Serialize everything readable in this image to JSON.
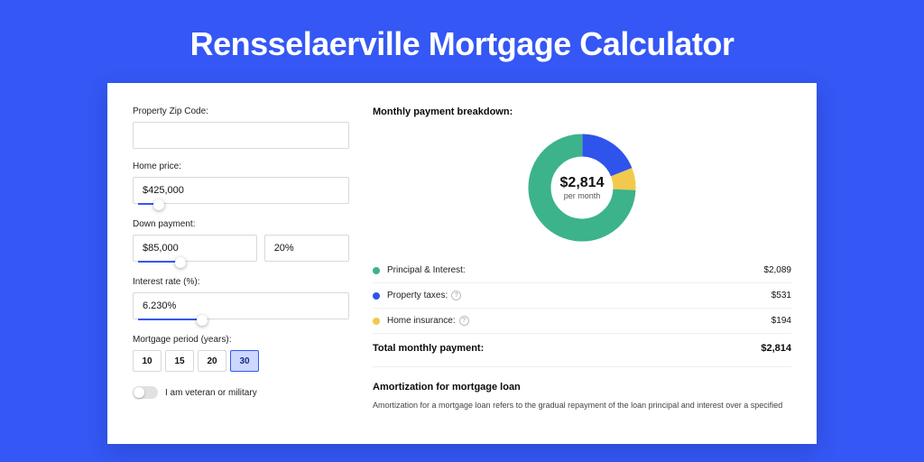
{
  "title": "Rensselaerville Mortgage Calculator",
  "left": {
    "zip_label": "Property Zip Code:",
    "zip_value": "",
    "home_price_label": "Home price:",
    "home_price_value": "$425,000",
    "down_payment_label": "Down payment:",
    "down_payment_value": "$85,000",
    "down_payment_pct": "20%",
    "interest_label": "Interest rate (%):",
    "interest_value": "6.230%",
    "period_label": "Mortgage period (years):",
    "periods": [
      "10",
      "15",
      "20",
      "30"
    ],
    "period_active": "30",
    "veteran_label": "I am veteran or military"
  },
  "right": {
    "title": "Monthly payment breakdown:",
    "center_amount": "$2,814",
    "center_sub": "per month",
    "rows": [
      {
        "label": "Principal & Interest:",
        "value": "$2,089",
        "color": "#3cb38a",
        "help": false
      },
      {
        "label": "Property taxes:",
        "value": "$531",
        "color": "#2f54eb",
        "help": true
      },
      {
        "label": "Home insurance:",
        "value": "$194",
        "color": "#f2c94c",
        "help": true
      }
    ],
    "total_label": "Total monthly payment:",
    "total_value": "$2,814",
    "amort_title": "Amortization for mortgage loan",
    "amort_text": "Amortization for a mortgage loan refers to the gradual repayment of the loan principal and interest over a specified"
  },
  "chart_data": {
    "type": "pie",
    "title": "Monthly payment breakdown",
    "series": [
      {
        "name": "Principal & Interest",
        "value": 2089,
        "color": "#3cb38a"
      },
      {
        "name": "Property taxes",
        "value": 531,
        "color": "#2f54eb"
      },
      {
        "name": "Home insurance",
        "value": 194,
        "color": "#f2c94c"
      }
    ],
    "total": 2814,
    "center_label": "$2,814 per month"
  }
}
